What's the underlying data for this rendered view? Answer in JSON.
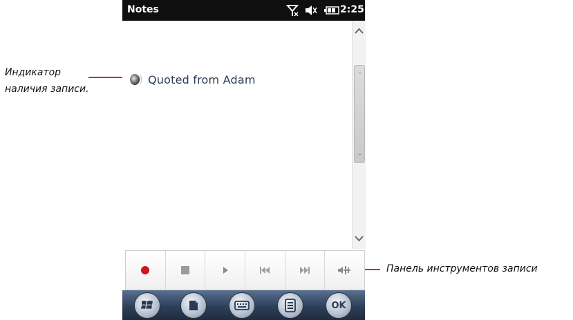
{
  "status_bar": {
    "title": "Notes",
    "time": "2:25",
    "icons": [
      "antenna-off-icon",
      "speaker-muted-icon",
      "battery-icon"
    ]
  },
  "note": {
    "text": "Quoted from Adam",
    "indicator_icon": "recording-indicator-icon"
  },
  "recording_toolbar": {
    "buttons": [
      "record-icon",
      "stop-icon",
      "play-icon",
      "skip-back-icon",
      "skip-forward-icon",
      "volume-icon"
    ]
  },
  "soft_keys": {
    "buttons": [
      "windows-start-icon",
      "new-note-icon",
      "keyboard-icon",
      "menu-list-icon"
    ],
    "ok_label": "OK"
  },
  "annotations": {
    "indicator_line1": "Индикатор",
    "indicator_line2": "наличия записи.",
    "toolbar_label": "Панель инструментов записи"
  },
  "colors": {
    "annotation_line": "#d9262b",
    "record_button": "#d0141c",
    "status_bar_bg": "#0f0f0f",
    "soft_bar_bg": "#2e3f58"
  }
}
